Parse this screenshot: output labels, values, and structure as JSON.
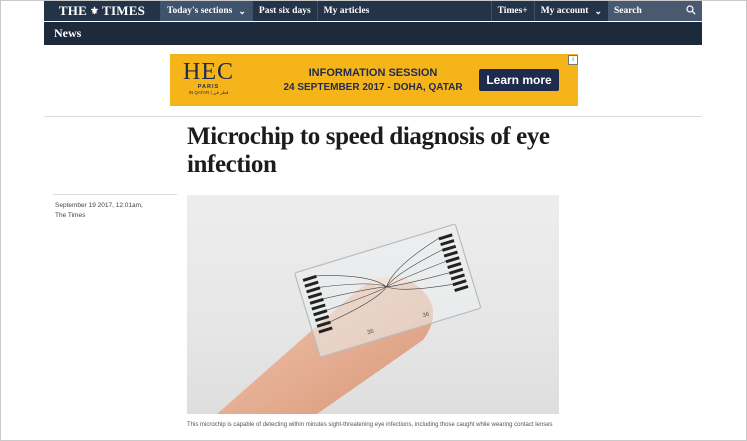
{
  "nav": {
    "logo_left": "THE",
    "logo_right": "TIMES",
    "items": [
      "Today's sections",
      "Past six days",
      "My articles"
    ],
    "times_plus": "Times+",
    "my_account": "My account",
    "search_label": "Search"
  },
  "subnav": {
    "section": "News"
  },
  "ad": {
    "brand": "HEC",
    "brand_sub": "PARIS",
    "brand_loc": "IN QATAR | قطر في",
    "title": "INFORMATION SESSION",
    "subtitle": "24 SEPTEMBER 2017 - DOHA, QATAR",
    "cta": "Learn more",
    "info": "i"
  },
  "article": {
    "headline": "Microchip to speed diagnosis of eye infection",
    "date": "September 19 2017, 12:01am,",
    "source": "The Times",
    "caption": "This microchip is capable of detecting within minutes sight-threatening eye infections, including those caught while wearing contact lenses"
  },
  "icons": {
    "search": "magnifier-icon",
    "chevron": "chevron-down-icon"
  },
  "colors": {
    "nav_bg": "#243448",
    "nav_active": "#3f536c",
    "subnav_bg": "#1c2a3b",
    "ad_bg": "#f6b41b",
    "ad_navy": "#1f2b4d"
  }
}
